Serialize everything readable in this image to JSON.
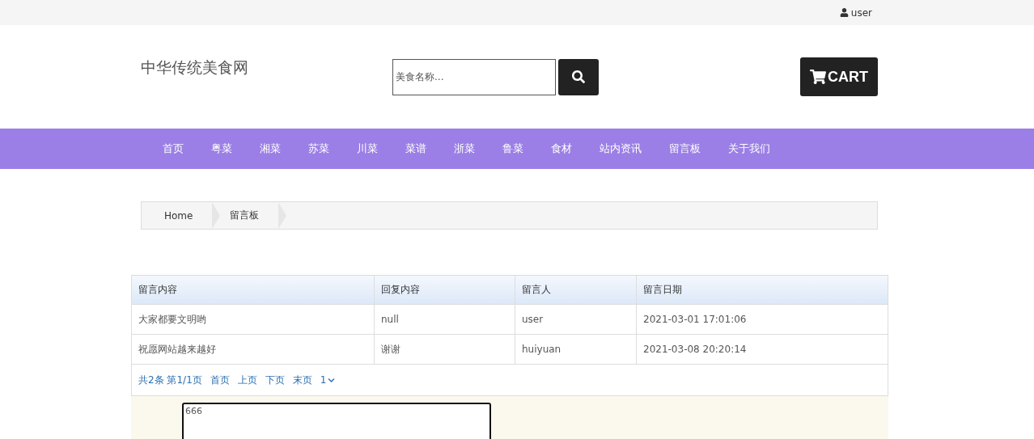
{
  "top_bar": {
    "user": "user"
  },
  "header": {
    "logo": "中华传统美食网",
    "search": {
      "placeholder": "美食名称..."
    },
    "cart": "CART"
  },
  "nav": {
    "items": [
      {
        "label": "首页"
      },
      {
        "label": "粤菜"
      },
      {
        "label": "湘菜"
      },
      {
        "label": "苏菜"
      },
      {
        "label": "川菜"
      },
      {
        "label": "菜谱"
      },
      {
        "label": "浙菜"
      },
      {
        "label": "鲁菜"
      },
      {
        "label": "食材"
      },
      {
        "label": "站内资讯"
      },
      {
        "label": "留言板"
      },
      {
        "label": "关于我们"
      }
    ]
  },
  "breadcrumb": [
    "Home",
    "留言板"
  ],
  "table": {
    "columns": [
      "留言内容",
      "回复内容",
      "留言人",
      "留言日期"
    ],
    "rows": [
      [
        "大家都要文明哟",
        "null",
        "user",
        "2021-03-01 17:01:06"
      ],
      [
        "祝愿网站越来越好",
        "谢谢",
        "huiyuan",
        "2021-03-08 20:20:14"
      ]
    ]
  },
  "pagination": {
    "summary": "共2条 第1/1页",
    "links": [
      "首页",
      "上页",
      "下页",
      "末页"
    ],
    "page_select": "1"
  },
  "message_form": {
    "value": "666"
  }
}
